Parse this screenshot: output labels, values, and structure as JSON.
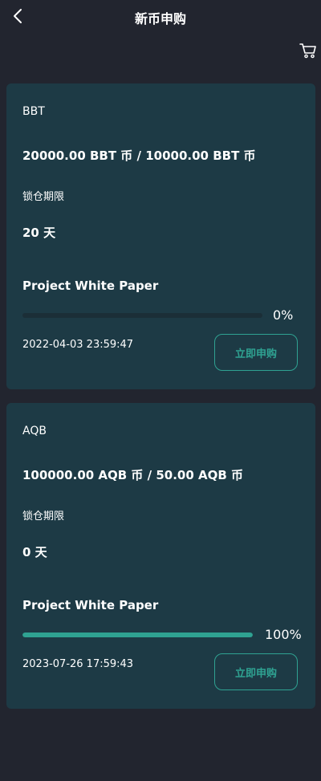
{
  "nav": {
    "title": "新币申购",
    "back_icon": "chevron-left-icon",
    "cart_icon": "cart-icon"
  },
  "colors": {
    "background": "#22252f",
    "card": "#1d3a45",
    "accent": "#2fa292",
    "track": "#1b2e37"
  },
  "items": [
    {
      "coin": "BBT",
      "amount": "20000.00 BBT 币 / 10000.00 BBT 币",
      "lock_label": "锁仓期限",
      "lock_value": "20 天",
      "whitepaper": "Project White Paper",
      "progress_percent": 0,
      "progress_label": "0%",
      "date": "2022-04-03 23:59:47",
      "buy_label": "立即申购"
    },
    {
      "coin": "AQB",
      "amount": "100000.00 AQB 币 / 50.00 AQB 币",
      "lock_label": "锁仓期限",
      "lock_value": "0 天",
      "whitepaper": "Project White Paper",
      "progress_percent": 100,
      "progress_label": "100%",
      "date": "2023-07-26 17:59:43",
      "buy_label": "立即申购"
    }
  ]
}
